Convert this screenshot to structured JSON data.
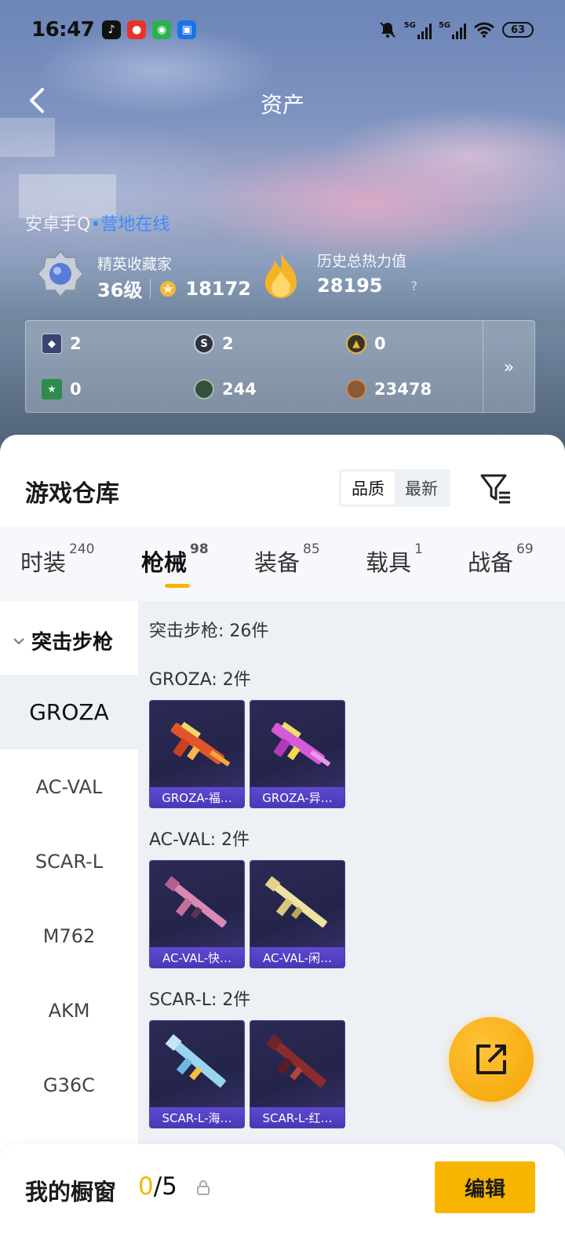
{
  "status_bar": {
    "time": "16:47",
    "network_1": "5G",
    "network_2": "5G",
    "battery": "63"
  },
  "header": {
    "title": "资产"
  },
  "profile": {
    "platform": "安卓手Q",
    "online_status": "营地在线",
    "collector_title": "精英收藏家",
    "collector_level": "36级",
    "collector_points": "18172",
    "heat_label": "历史总热力值",
    "heat_value": "28195",
    "help_mark": "?"
  },
  "assets": [
    {
      "icon": "card-icon",
      "value": "2"
    },
    {
      "icon": "silver-coin-icon",
      "value": "2"
    },
    {
      "icon": "gold-coin-icon",
      "value": "0"
    },
    {
      "icon": "green-ticket-icon",
      "value": "0"
    },
    {
      "icon": "green-coin-icon",
      "value": "244"
    },
    {
      "icon": "bronze-coin-icon",
      "value": "23478"
    }
  ],
  "warehouse": {
    "title": "游戏仓库",
    "sort_quality": "品质",
    "sort_latest": "最新",
    "tabs": [
      {
        "label": "时装",
        "count": "240"
      },
      {
        "label": "枪械",
        "count": "98"
      },
      {
        "label": "装备",
        "count": "85"
      },
      {
        "label": "载具",
        "count": "1"
      },
      {
        "label": "战备",
        "count": "69"
      }
    ],
    "category": "突击步枪",
    "category_count": "突击步枪: 26件",
    "side_items": [
      "GROZA",
      "AC-VAL",
      "SCAR-L",
      "M762",
      "AKM",
      "G36C"
    ],
    "groups": [
      {
        "title": "GROZA: 2件",
        "items": [
          "GROZA-福…",
          "GROZA-异…"
        ]
      },
      {
        "title": "AC-VAL: 2件",
        "items": [
          "AC-VAL-快…",
          "AC-VAL-闲…"
        ]
      },
      {
        "title": "SCAR-L: 2件",
        "items": [
          "SCAR-L-海…",
          "SCAR-L-红…"
        ]
      }
    ]
  },
  "showcase": {
    "label": "我的橱窗",
    "used": "0",
    "total": "/5",
    "edit": "编辑"
  },
  "colors": {
    "accent": "#f7b500",
    "online_blue": "#3a8bff",
    "card_bg": "#2c2a55",
    "card_label": "#5e4ad0"
  }
}
